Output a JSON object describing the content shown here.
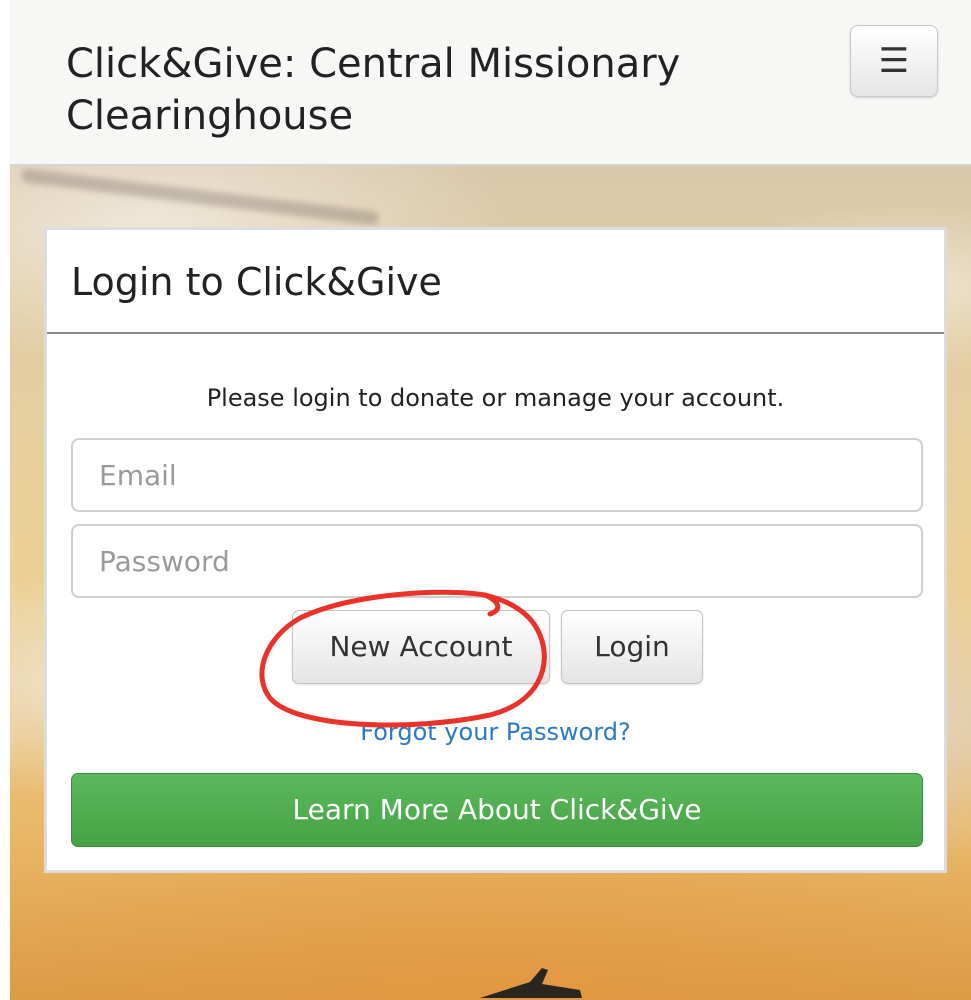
{
  "navbar": {
    "brand": "Click&Give: Central Missionary Clearinghouse",
    "menu_icon": "hamburger-menu-icon"
  },
  "login_panel": {
    "title": "Login to Click&Give",
    "intro": "Please login to donate or manage your account.",
    "email_placeholder": "Email",
    "password_placeholder": "Password",
    "new_account_label": "New Account",
    "login_label": "Login",
    "forgot_password_label": "Forgot your Password?",
    "learn_more_label": "Learn More About Click&Give"
  },
  "colors": {
    "link": "#2a79c2",
    "success_button": "#4cae4c",
    "annotation": "#e8322a"
  }
}
